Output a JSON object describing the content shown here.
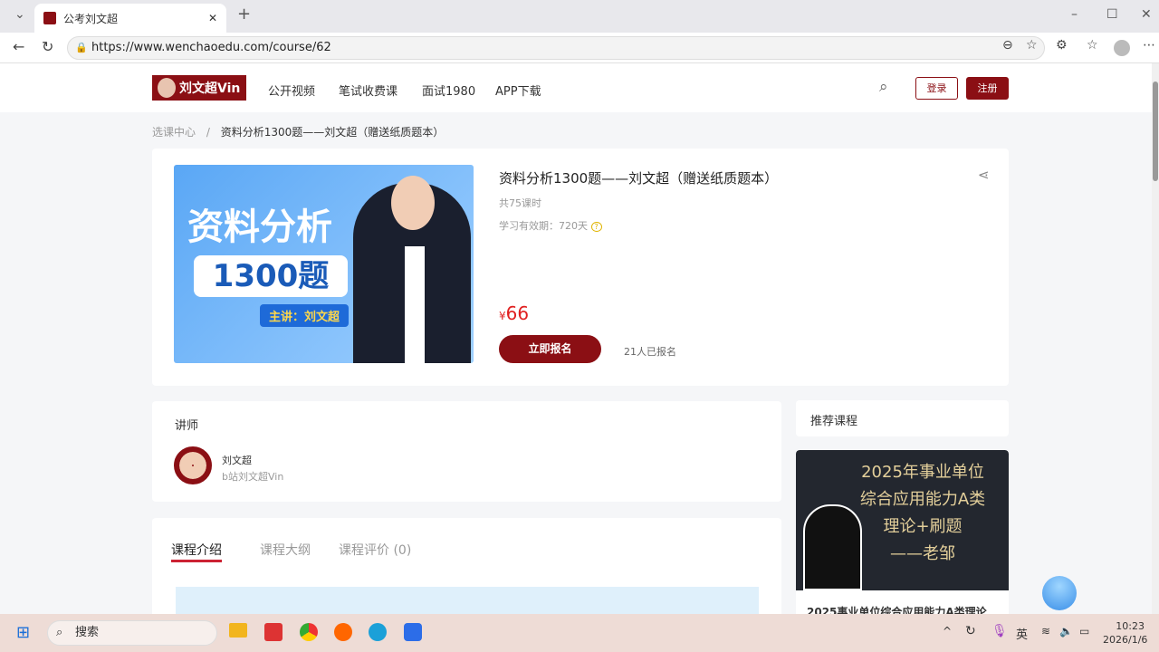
{
  "browser": {
    "tab_title": "公考刘文超",
    "url": "https://www.wenchaoedu.com/course/62"
  },
  "header": {
    "logo": "刘文超Vin",
    "nav": [
      "公开视频",
      "笔试收费课",
      "面试1980",
      "APP下载"
    ],
    "login": "登录",
    "register": "注册"
  },
  "breadcrumb": {
    "root": "选课中心",
    "sep": "/",
    "current": "资料分析1300题——刘文超（赠送纸质题本）"
  },
  "course": {
    "title": "资料分析1300题——刘文超（赠送纸质题本）",
    "lessons": "共75课时",
    "validity": "学习有效期：720天",
    "currency": "¥",
    "price": "66",
    "enroll": "立即报名",
    "enrolled": "21人已报名",
    "cover": {
      "line1": "资料分析",
      "line2": "1300题",
      "line3": "主讲：刘文超"
    }
  },
  "teacher": {
    "heading": "讲师",
    "name": "刘文超",
    "sub": "b站刘文超Vin"
  },
  "tabs": [
    "课程介绍",
    "课程大纲",
    "课程评价 (0)"
  ],
  "recommend": {
    "heading": "推荐课程",
    "cover_lines": [
      "2025年事业单位",
      "综合应用能力A类",
      "理论+刷题",
      "——老邹"
    ],
    "title": "2025事业单位综合应用能力A类理论"
  },
  "taskbar": {
    "search": "搜索",
    "ime": "英",
    "time": "10:23",
    "date": "2026/1/6"
  }
}
